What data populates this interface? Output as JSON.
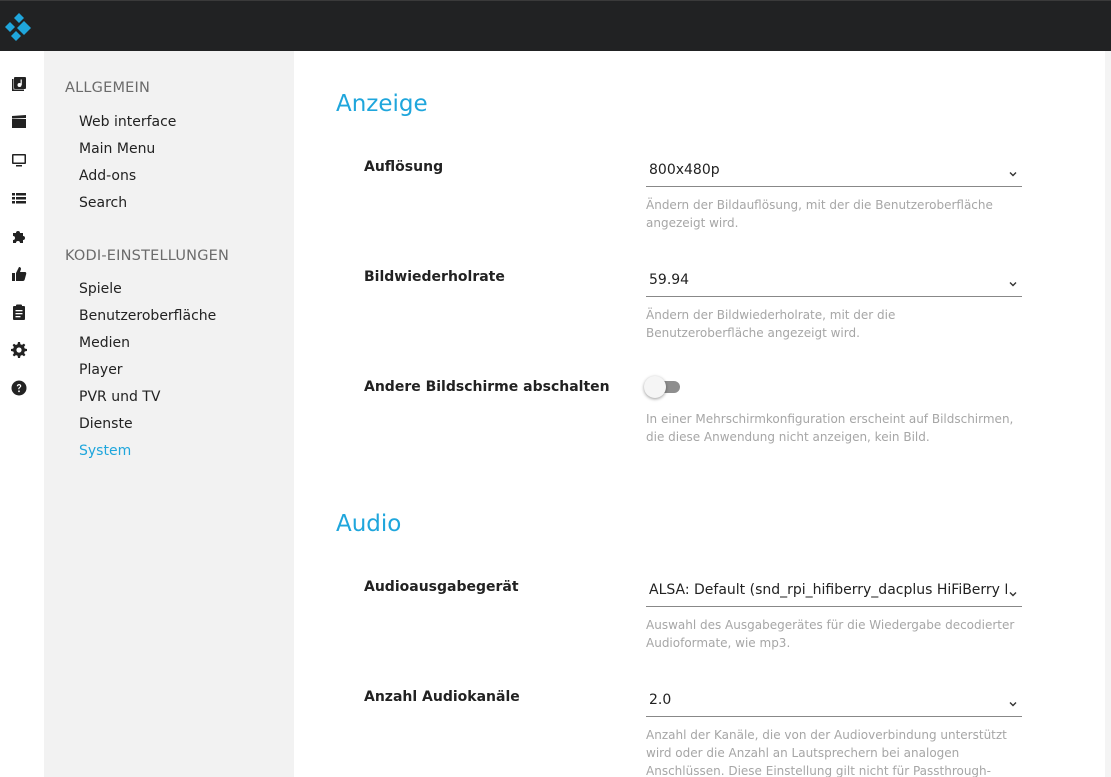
{
  "topbar": {
    "logo_icon": "kodi-logo-icon",
    "accent": "#1fa6dc"
  },
  "iconbar": {
    "icons": [
      "music-library-icon",
      "movies-icon",
      "tv-icon",
      "list-icon",
      "addons-puzzle-icon",
      "thumbs-up-icon",
      "clipboard-icon",
      "gear-icon",
      "help-icon"
    ]
  },
  "leftnav": {
    "group1": {
      "heading": "ALLGEMEIN",
      "items": [
        "Web interface",
        "Main Menu",
        "Add-ons",
        "Search"
      ]
    },
    "group2": {
      "heading": "KODI-EINSTELLUNGEN",
      "items": [
        "Spiele",
        "Benutzeroberfläche",
        "Medien",
        "Player",
        "PVR und TV",
        "Dienste",
        "System"
      ],
      "active": "System"
    }
  },
  "content": {
    "display": {
      "title": "Anzeige",
      "resolution": {
        "label": "Auflösung",
        "value": "800x480p",
        "help": "Ändern der Bildauflösung, mit der die Benutzeroberfläche angezeigt wird."
      },
      "refresh": {
        "label": "Bildwiederholrate",
        "value": "59.94",
        "help": "Ändern der Bildwiederholrate, mit der die Benutzeroberfläche angezeigt wird."
      },
      "blank": {
        "label": "Andere Bildschirme abschalten",
        "enabled": false,
        "help": "In einer Mehrschirmkonfiguration erscheint auf Bildschirmen, die diese Anwendung nicht anzeigen, kein Bild."
      }
    },
    "audio": {
      "title": "Audio",
      "device": {
        "label": "Audioausgabegerät",
        "value": "ALSA: Default (snd_rpi_hifiberry_dacplus HiFiBerry DAC+",
        "help": "Auswahl des Ausgabegerätes für die Wiedergabe decodierter Audioformate, wie mp3."
      },
      "channels": {
        "label": "Anzahl Audiokanäle",
        "value": "2.0",
        "help": "Anzahl der Kanäle, die von der Audioverbindung unterstützt wird oder die Anzahl an Lautsprechern bei analogen Anschlüssen. Diese Einstellung gilt nicht für Passthrough-Audio."
      }
    }
  }
}
